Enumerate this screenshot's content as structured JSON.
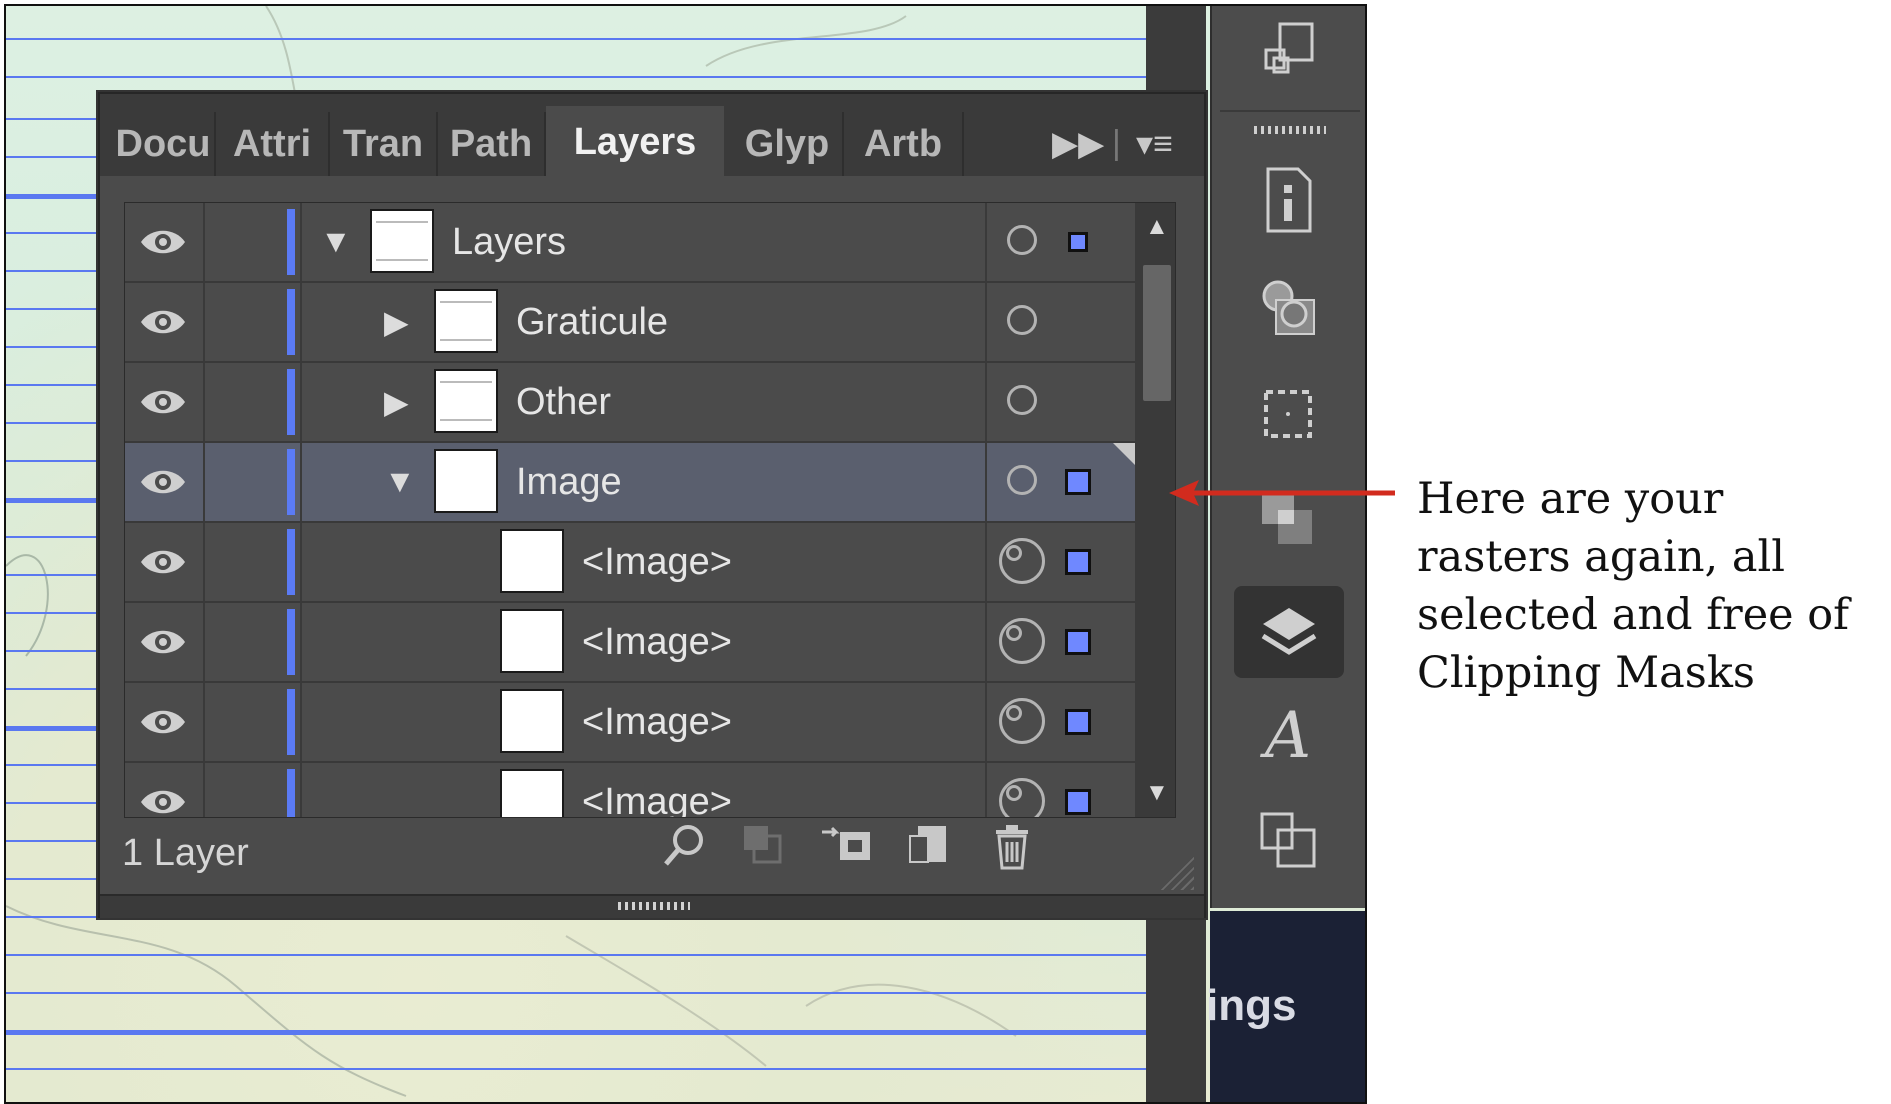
{
  "panel": {
    "tabs": [
      {
        "label": "Docu",
        "active": false
      },
      {
        "label": "Attri",
        "active": false
      },
      {
        "label": "Tran",
        "active": false
      },
      {
        "label": "Path",
        "active": false
      },
      {
        "label": "Layers",
        "active": true
      },
      {
        "label": "Glyp",
        "active": false
      },
      {
        "label": "Artb",
        "active": false
      }
    ],
    "collapse_glyph": "▶▶",
    "menu_glyph": "▾≡",
    "layers": [
      {
        "name": "Layers",
        "expanded": true,
        "level": 0,
        "selected": false,
        "has_selection": true
      },
      {
        "name": "Graticule",
        "expanded": false,
        "level": 1,
        "selected": false,
        "has_selection": false
      },
      {
        "name": "Other",
        "expanded": false,
        "level": 1,
        "selected": false,
        "has_selection": false
      },
      {
        "name": "Image",
        "expanded": true,
        "level": 1,
        "selected": true,
        "has_selection": true
      },
      {
        "name": "<Image>",
        "level": 2,
        "selected": false,
        "has_selection": true
      },
      {
        "name": "<Image>",
        "level": 2,
        "selected": false,
        "has_selection": true
      },
      {
        "name": "<Image>",
        "level": 2,
        "selected": false,
        "has_selection": true
      },
      {
        "name": "<Image>",
        "level": 2,
        "selected": false,
        "has_selection": true
      }
    ],
    "footer": {
      "status": "1 Layer",
      "icons": [
        "search-icon",
        "collect-for-export-icon",
        "make-clipping-mask-icon",
        "new-sublayer-icon",
        "new-layer-icon",
        "trash-icon"
      ]
    }
  },
  "background_text": "ings",
  "annotation": "Here are your rasters again, all selected and free of Clipping Masks",
  "colors": {
    "layer_color": "#5b7bf5",
    "selection_square": "#6f88ff",
    "panel_bg": "#4b4b4b",
    "arrow": "#d22b1e"
  },
  "toolstrip_icons": [
    "arrange-documents-icon",
    "document-info-icon",
    "color-guide-icon",
    "artboard-icon",
    "pathfinder-icon",
    "layers-icon",
    "character-styles-icon",
    "transform-icon"
  ]
}
